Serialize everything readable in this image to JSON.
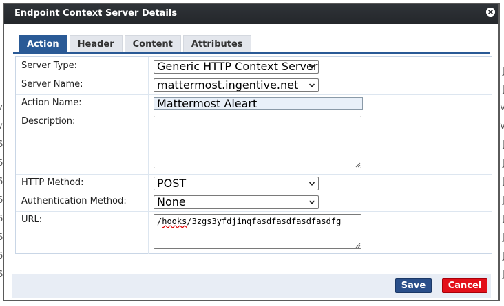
{
  "dialog": {
    "title": "Endpoint Context Server Details",
    "close_icon": "close-circle-icon"
  },
  "tabs": [
    {
      "label": "Action",
      "active": true
    },
    {
      "label": "Header",
      "active": false
    },
    {
      "label": "Content",
      "active": false
    },
    {
      "label": "Attributes",
      "active": false
    }
  ],
  "form": {
    "server_type": {
      "label": "Server Type:",
      "value": "Generic HTTP Context Server"
    },
    "server_name": {
      "label": "Server Name:",
      "value": "mattermost.ingentive.net"
    },
    "action_name": {
      "label": "Action Name:",
      "value": "Mattermost Aleart"
    },
    "description": {
      "label": "Description:",
      "value": ""
    },
    "http_method": {
      "label": "HTTP Method:",
      "value": "POST"
    },
    "auth_method": {
      "label": "Authentication Method:",
      "value": "None"
    },
    "url": {
      "label": "URL:",
      "value_prefix": "/",
      "value_underlined": "hooks",
      "value_rest": "/3zgs3yfdjinqfasdfasdfasdfasdfg"
    }
  },
  "footer": {
    "save_label": "Save",
    "cancel_label": "Cancel"
  },
  "colors": {
    "tab_active": "#2a5a96",
    "save_button": "#2a4f8a",
    "cancel_button": "#e3101a"
  }
}
